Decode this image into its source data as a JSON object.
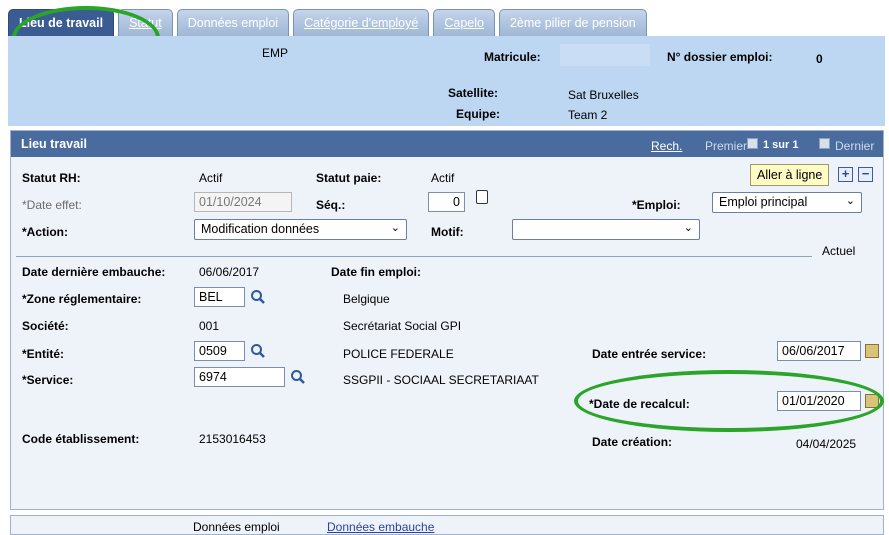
{
  "tabs": [
    {
      "label": "Lieu de travail",
      "active": true
    },
    {
      "label": "Statut",
      "active": false
    },
    {
      "label": "Données emploi",
      "active": false
    },
    {
      "label": "Catégorie d'employé",
      "active": false
    },
    {
      "label": "Capelo",
      "active": false
    },
    {
      "label": "2ème pilier de pension",
      "active": false
    }
  ],
  "header": {
    "emp": "EMP",
    "matricule_label": "Matricule:",
    "matricule_value": "",
    "dossier_label": "N° dossier emploi:",
    "dossier_value": "0",
    "satellite_label": "Satellite:",
    "satellite_value": "Sat Bruxelles",
    "equipe_label": "Equipe:",
    "equipe_value": "Team 2"
  },
  "panel": {
    "title": "Lieu travail",
    "search_link": "Rech.",
    "first": "Premier",
    "counter": "1 sur 1",
    "last": "Dernier",
    "add_line_button": "Aller à ligne"
  },
  "fields": {
    "statut_rh_label": "Statut RH:",
    "statut_rh_value": "Actif",
    "statut_paie_label": "Statut paie:",
    "statut_paie_value": "Actif",
    "date_effet_label": "*Date effet:",
    "date_effet_value": "01/10/2024",
    "seq_label": "Séq.:",
    "seq_value": "0",
    "emploi_label": "*Emploi:",
    "emploi_value": "Emploi principal",
    "action_label": "*Action:",
    "action_value": "Modification données",
    "motif_label": "Motif:",
    "motif_value": "",
    "actuel": "Actuel",
    "date_derniere_embauche_label": "Date dernière embauche:",
    "date_derniere_embauche_value": "06/06/2017",
    "date_fin_emploi_label": "Date fin emploi:",
    "zone_label": "*Zone réglementaire:",
    "zone_value": "BEL",
    "zone_desc": "Belgique",
    "societe_label": "Société:",
    "societe_value": "001",
    "societe_desc": "Secrétariat Social GPI",
    "entite_label": "*Entité:",
    "entite_value": "0509",
    "entite_desc": "POLICE FEDERALE",
    "date_entree_label": "Date entrée service:",
    "date_entree_value": "06/06/2017",
    "service_label": "*Service:",
    "service_value": "6974",
    "service_desc": "SSGPII - SOCIAAL SECRETARIAAT",
    "date_recalcul_label": "*Date de recalcul:",
    "date_recalcul_value": "01/01/2020",
    "code_etab_label": "Code établissement:",
    "code_etab_value": "2153016453",
    "date_creation_label": "Date création:",
    "date_creation_value": "04/04/2025"
  },
  "footer": {
    "donnees_emploi": "Données emploi",
    "donnees_embauche": "Données embauche"
  },
  "colors": {
    "highlight_oval": "#2aa52a",
    "header_bg": "#bdd7f2",
    "panel_head": "#4a6b9e"
  }
}
